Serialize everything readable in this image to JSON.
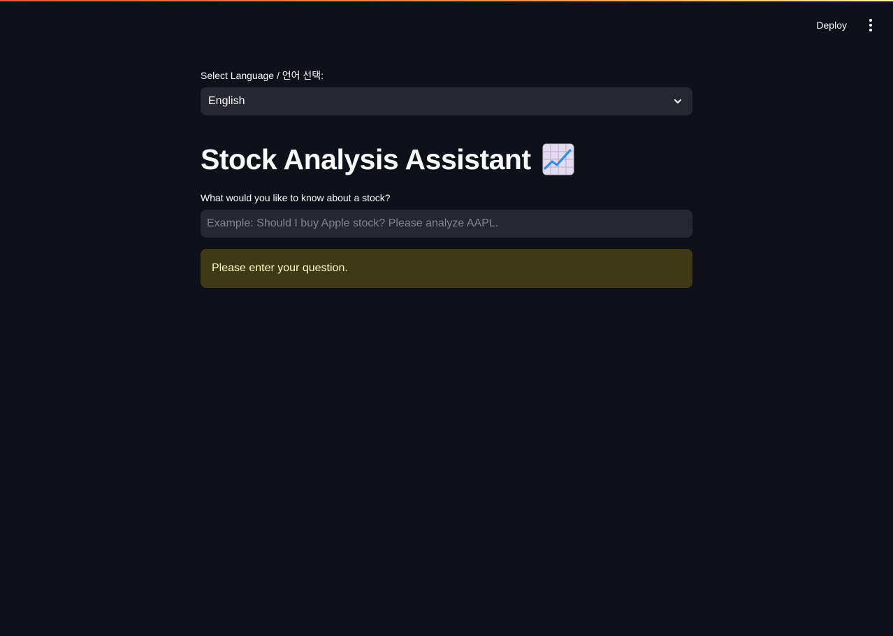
{
  "header": {
    "deploy_label": "Deploy",
    "menu_icon": "kebab-menu-icon"
  },
  "language_select": {
    "label": "Select Language / 언어 선택:",
    "value": "English",
    "icon": "chevron-down-icon"
  },
  "page": {
    "title": "Stock Analysis Assistant",
    "title_icon": "chart-increasing-icon"
  },
  "question_input": {
    "label": "What would you like to know about a stock?",
    "value": "",
    "placeholder": "Example: Should I buy Apple stock? Please analyze AAPL."
  },
  "alert": {
    "message": "Please enter your question."
  },
  "colors": {
    "background": "#0e1117",
    "input_bg": "#262730",
    "warning_bg": "#3e3a16",
    "warning_text": "#ffffc2",
    "accent_gradient_start": "#ff4b4b",
    "accent_gradient_end": "#fffd80"
  }
}
